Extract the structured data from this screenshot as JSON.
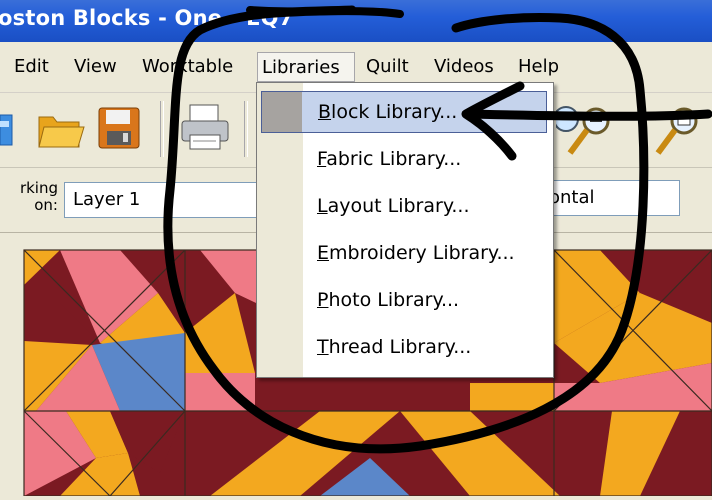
{
  "window": {
    "title": "oston Blocks - One - EQ7"
  },
  "menubar": {
    "items": [
      {
        "label": "Edit"
      },
      {
        "label": "View"
      },
      {
        "label": "Worktable"
      },
      {
        "label": "Libraries"
      },
      {
        "label": "Quilt"
      },
      {
        "label": "Videos"
      },
      {
        "label": "Help"
      }
    ]
  },
  "toolbar": {
    "icons": [
      "new-icon",
      "open-folder-icon",
      "save-icon",
      "print-icon",
      "zoom-in-icon",
      "zoom-out-icon"
    ]
  },
  "worktable": {
    "label_line1": "rking",
    "label_line2": "on:",
    "layer_value": "Layer 1",
    "orientation_value": "ontal"
  },
  "libraries_menu": {
    "items": [
      {
        "pre": "",
        "key": "B",
        "rest": "lock Library...",
        "highlighted": true
      },
      {
        "pre": "",
        "key": "F",
        "rest": "abric Library...",
        "highlighted": false
      },
      {
        "pre": "",
        "key": "L",
        "rest": "ayout Library...",
        "highlighted": false
      },
      {
        "pre": "",
        "key": "E",
        "rest": "mbroidery Library...",
        "highlighted": false
      },
      {
        "pre": "",
        "key": "P",
        "rest": "hoto Library...",
        "highlighted": false
      },
      {
        "pre": "",
        "key": "T",
        "rest": "hread Library...",
        "highlighted": false
      }
    ]
  },
  "colors": {
    "titlebar": "#245ed8",
    "maroon": "#7b1a22",
    "gold": "#f3a81f",
    "pink": "#ef7a86",
    "blue": "#5b87c9",
    "highlight": "#c5d3ec",
    "annotation_ink": "#000000"
  }
}
